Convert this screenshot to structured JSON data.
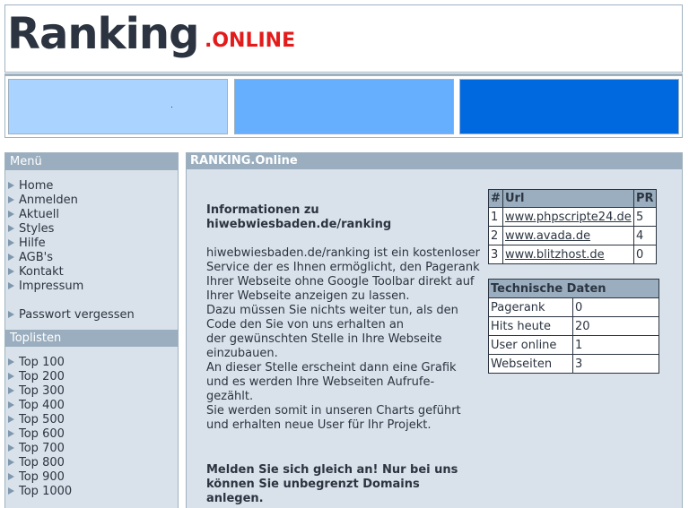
{
  "header": {
    "logo_main": "Ranking",
    "logo_suffix": ".ONLINE"
  },
  "sidebar": {
    "menu_title": "Menü",
    "menu_items": [
      "Home",
      "Anmelden",
      "Aktuell",
      "Styles",
      "Hilfe",
      "AGB's",
      "Kontakt",
      "Impressum"
    ],
    "extra_item": "Passwort vergessen",
    "toplisten_title": "Toplisten",
    "toplisten_items": [
      "Top 100",
      "Top 200",
      "Top 300",
      "Top 400",
      "Top 500",
      "Top 600",
      "Top 700",
      "Top 800",
      "Top 900",
      "Top 1000"
    ]
  },
  "main": {
    "title": "RANKING.Online",
    "info_title": "Informationen zu hiwebwiesbaden.de/ranking",
    "info_body": "hiwebwiesbaden.de/ranking ist ein kostenloser Service der es Ihnen ermöglicht, den Pagerank\nIhrer Webseite ohne Google Toolbar direkt auf Ihrer Webseite anzeigen zu lassen.\nDazu müssen Sie nichts weiter tun, als den Code den Sie von uns erhalten an\nder gewünschten Stelle in Ihre Webseite einzubauen.\nAn dieser Stelle erscheint dann eine Grafik und es werden Ihre Webseiten Aufrufe-gezählt.\nSie werden somit in unseren Charts geführt und erhalten neue User für Ihr Projekt.",
    "cta": "Melden Sie sich gleich an! Nur bei uns können Sie unbegrenzt Domains anlegen."
  },
  "ranking_table": {
    "headers": [
      "#",
      "Url",
      "PR"
    ],
    "rows": [
      [
        "1",
        "www.phpscripte24.de",
        "5"
      ],
      [
        "2",
        "www.avada.de",
        "4"
      ],
      [
        "3",
        "www.blitzhost.de",
        "0"
      ]
    ]
  },
  "tech_table": {
    "title": "Technische Daten",
    "rows": [
      [
        "Pagerank",
        "0"
      ],
      [
        "Hits heute",
        "20"
      ],
      [
        "User online",
        "1"
      ],
      [
        "Webseiten",
        "3"
      ]
    ]
  },
  "colors": {
    "banner_1": "#aad4ff",
    "banner_2": "#66afff",
    "banner_3": "#0069e0",
    "logo_accent": "#e41b1b",
    "panel_bg": "#d9e2ea",
    "panel_head": "#9aaebf"
  },
  "icons": {
    "list_bullet": "triangle-right-icon"
  }
}
